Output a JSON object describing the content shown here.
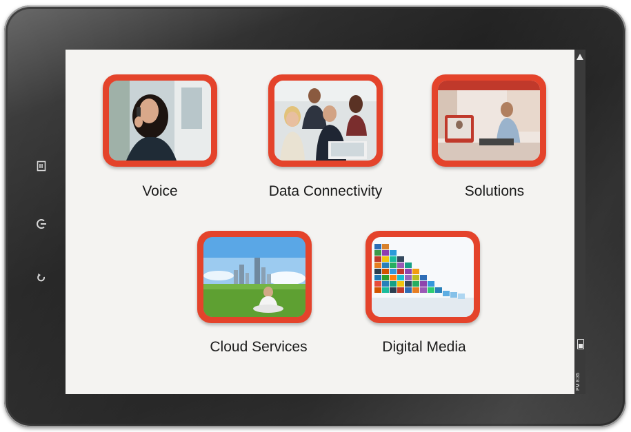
{
  "tiles": [
    {
      "label": "Voice",
      "image": "woman-on-phone-photo"
    },
    {
      "label": "Data Connectivity",
      "image": "business-team-laptop-photo"
    },
    {
      "label": "Solutions",
      "image": "video-conference-office-photo"
    },
    {
      "label": "Cloud Services",
      "image": "man-meditating-city-skyline-photo"
    },
    {
      "label": "Digital Media",
      "image": "stacked-screens-photo"
    }
  ],
  "device": {
    "side_buttons": [
      "menu-icon",
      "power-icon",
      "back-icon"
    ],
    "status_bar": {
      "clock": "PM 8:35"
    }
  },
  "colors": {
    "tile_frame": "#e4432b",
    "screen_bg": "#f4f3f1",
    "bezel": "#1b1b1b"
  }
}
